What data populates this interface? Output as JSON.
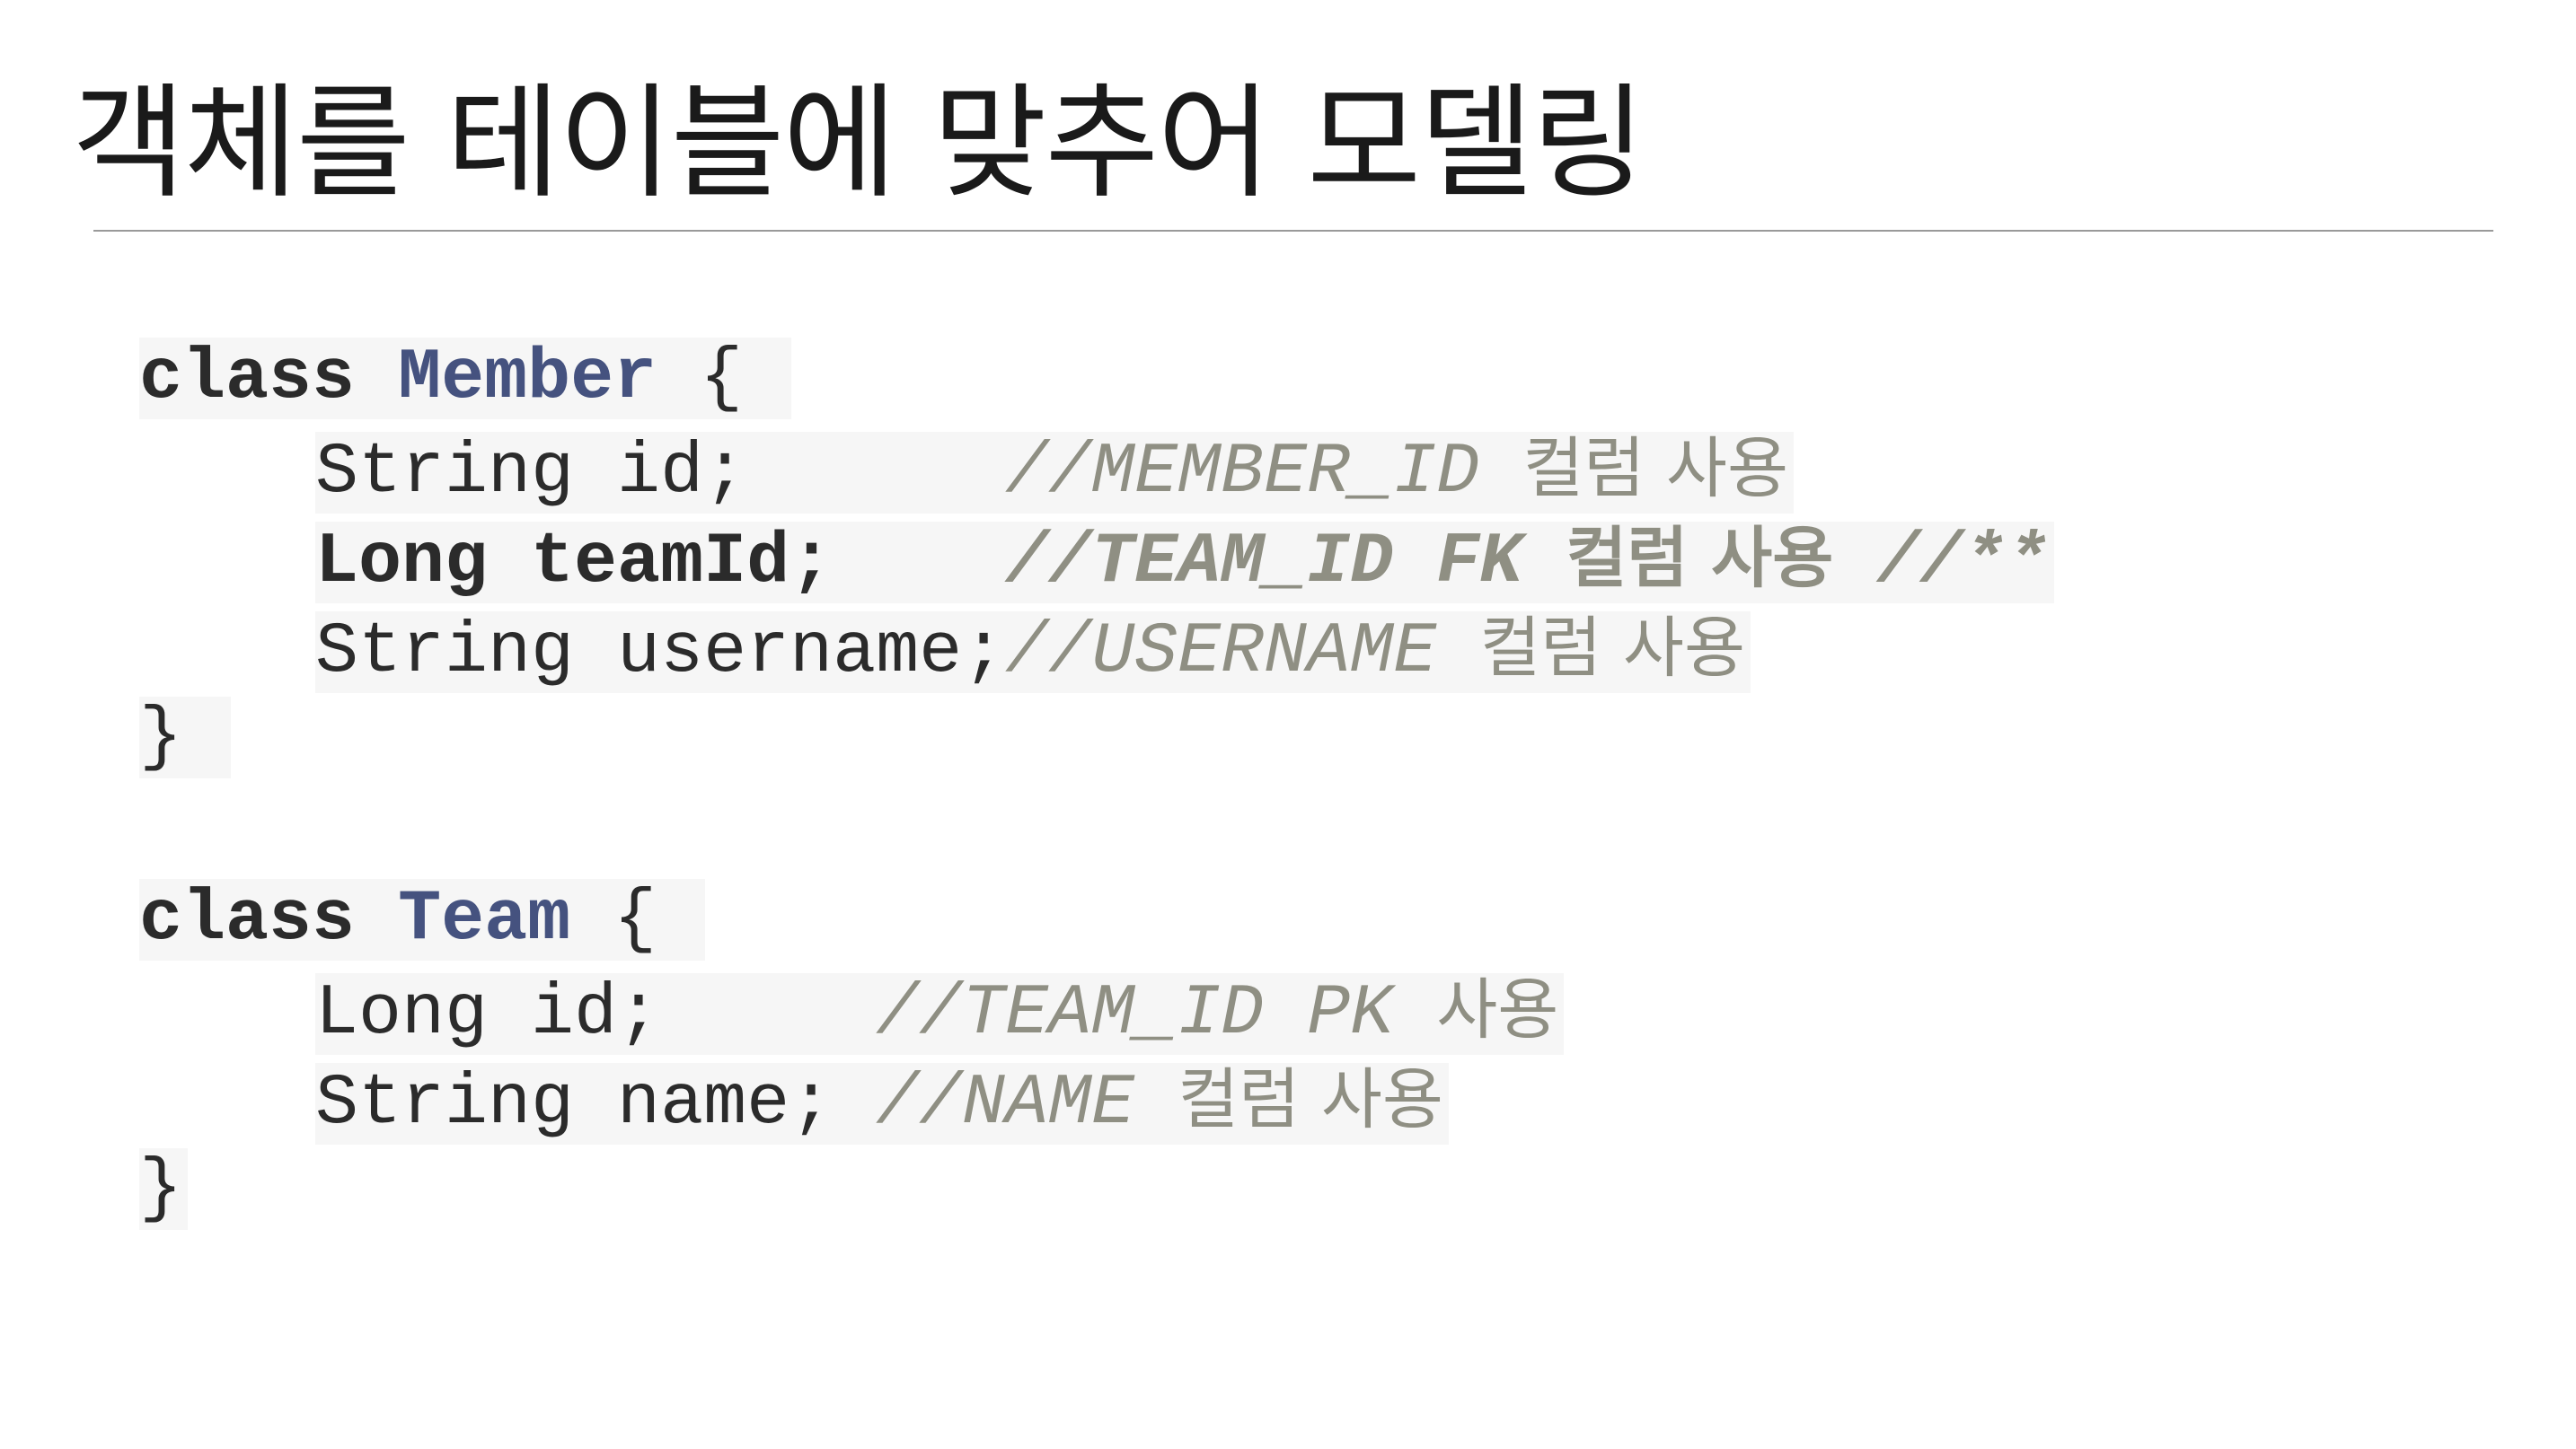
{
  "slide": {
    "title": "객체를 테이블에 맞추어 모델링"
  },
  "member_block": {
    "kw_class": "class",
    "class_name": "Member",
    "open_brace": "{",
    "fields": [
      {
        "code": "String id;",
        "comment_code": "//MEMBER_ID",
        "comment_text": "컬럼 사용",
        "comment_tail": ""
      },
      {
        "code": "Long teamId;",
        "comment_code": "//TEAM_ID FK",
        "comment_text": "컬럼 사용",
        "comment_tail": "//**"
      },
      {
        "code": "String username;",
        "comment_code": "//USERNAME",
        "comment_text": "컬럼 사용",
        "comment_tail": ""
      }
    ],
    "close_brace": "}"
  },
  "team_block": {
    "kw_class": "class",
    "class_name": "Team",
    "open_brace": "{",
    "fields": [
      {
        "code": "Long id;",
        "comment_code": "//TEAM_ID PK",
        "comment_text": "사용"
      },
      {
        "code": "String name;",
        "comment_code": "//NAME",
        "comment_text": "컬럼 사용"
      }
    ],
    "close_brace": "}"
  },
  "colors": {
    "title": "#1a1a1a",
    "rule": "#9a9a9a",
    "code_text": "#2b2b2b",
    "class_name": "#45527f",
    "comment": "#8f8f83",
    "code_background": "#f6f6f6"
  }
}
